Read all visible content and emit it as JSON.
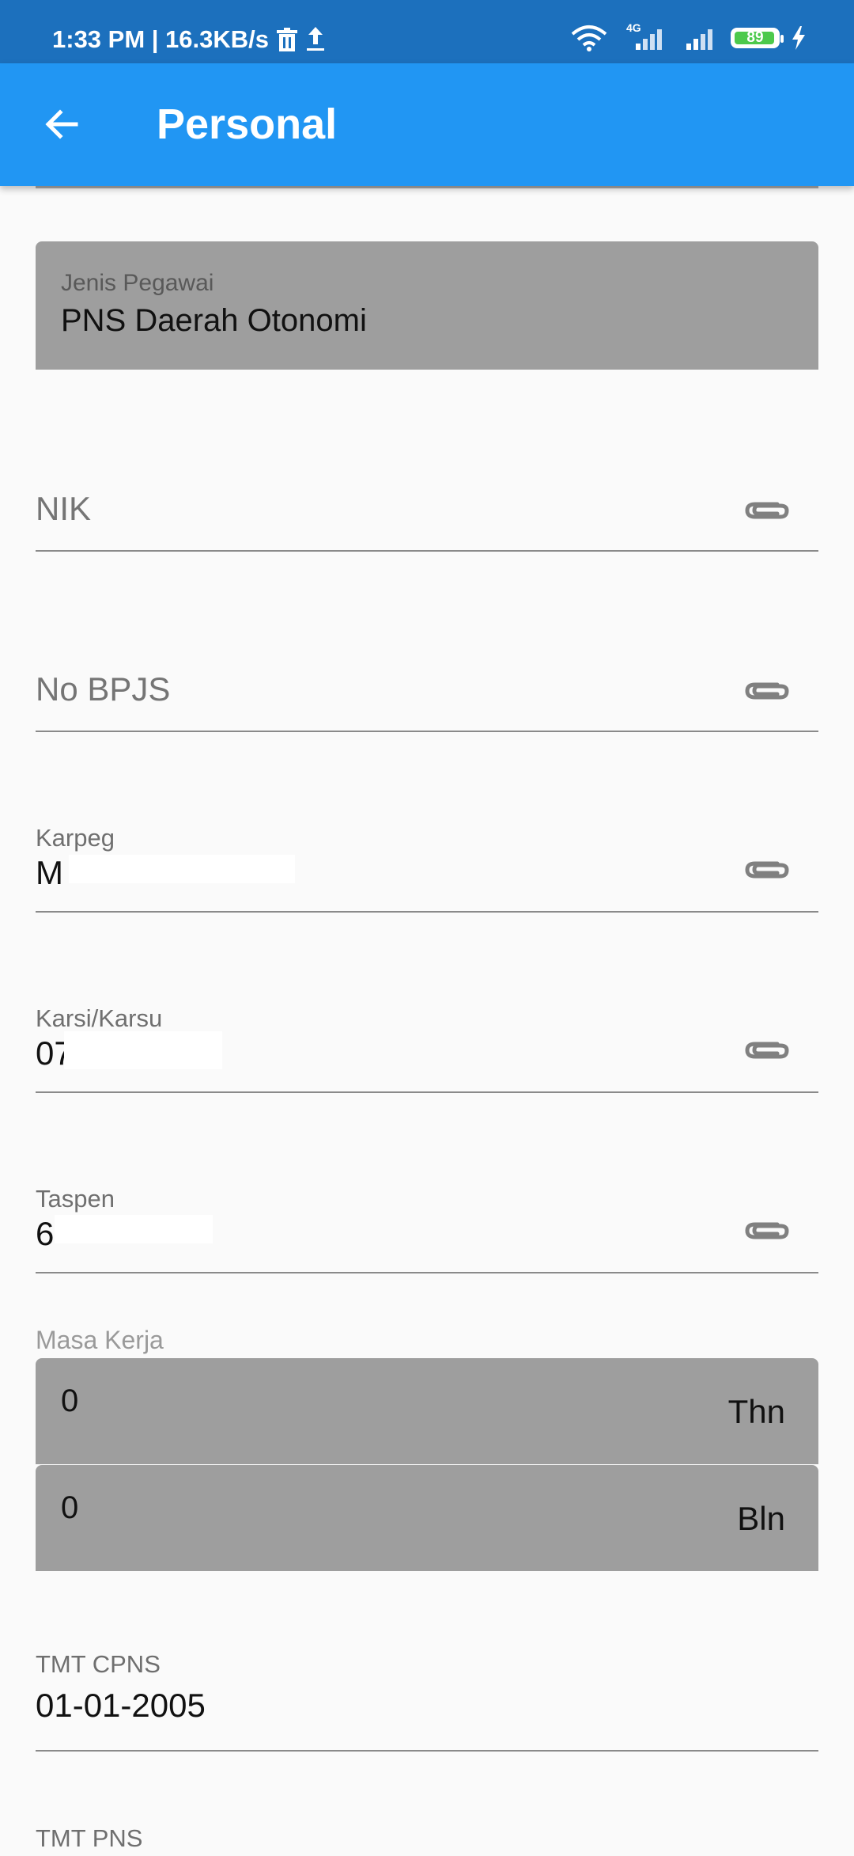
{
  "status_bar": {
    "time_speed": "1:33 PM | 16.3KB/s",
    "network": "4G",
    "battery": "89"
  },
  "app_bar": {
    "title": "Personal",
    "back_icon": "arrow-left-icon"
  },
  "form": {
    "jenis_pegawai": {
      "label": "Jenis Pegawai",
      "value": "PNS Daerah Otonomi"
    },
    "nik": {
      "placeholder": "NIK",
      "icon": "paperclip-icon"
    },
    "no_bpjs": {
      "placeholder": "No BPJS",
      "icon": "paperclip-icon"
    },
    "karpeg": {
      "label": "Karpeg",
      "value_visible": "M",
      "icon": "paperclip-icon"
    },
    "karsi": {
      "label": "Karsi/Karsu",
      "value_visible": "07",
      "icon": "paperclip-icon"
    },
    "taspen": {
      "label": "Taspen",
      "value_visible": "6",
      "icon": "paperclip-icon"
    },
    "masa_kerja": {
      "label": "Masa Kerja",
      "years": "0",
      "years_unit": "Thn",
      "months": "0",
      "months_unit": "Bln"
    },
    "tmt_cpns": {
      "label": "TMT CPNS",
      "value": "01-01-2005"
    },
    "tmt_pns": {
      "label": "TMT PNS"
    }
  }
}
